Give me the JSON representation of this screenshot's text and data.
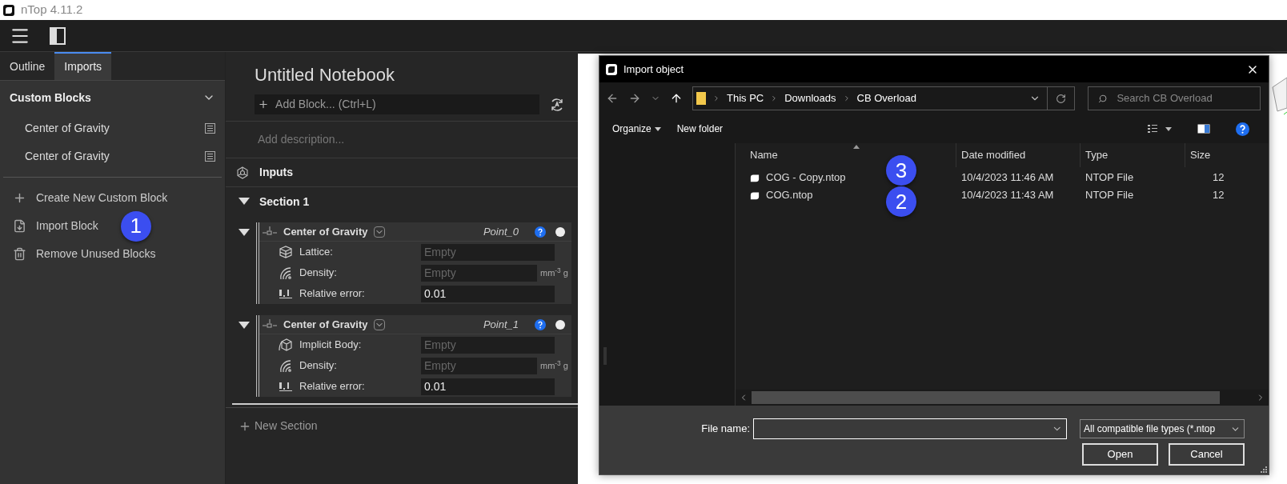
{
  "window": {
    "title": "nTop 4.11.2"
  },
  "sidebar": {
    "tabs": [
      {
        "label": "Outline",
        "selected": false
      },
      {
        "label": "Imports",
        "selected": true
      }
    ],
    "custom_blocks": {
      "title": "Custom Blocks",
      "expanded": true,
      "items": [
        "Center of Gravity",
        "Center of Gravity"
      ]
    },
    "actions": [
      {
        "kind": "create",
        "label": "Create New Custom Block"
      },
      {
        "kind": "import",
        "label": "Import Block",
        "callout": "1"
      },
      {
        "kind": "remove",
        "label": "Remove Unused Blocks"
      }
    ]
  },
  "notebook": {
    "title": "Untitled Notebook",
    "add_block": {
      "placeholder": "Add Block... (Ctrl+L)"
    },
    "description": {
      "placeholder": "Add description..."
    },
    "inputs": "Inputs",
    "section": {
      "title": "Section 1",
      "expanded": true,
      "blocks": [
        {
          "title": "Center of Gravity",
          "variable": "Point_0",
          "expanded": true,
          "params": [
            {
              "kind": "lattice",
              "label": "Lattice:",
              "placeholder": "Empty"
            },
            {
              "kind": "density",
              "label": "Density:",
              "placeholder": "Empty",
              "unit": "mm$^{-3}$ g"
            },
            {
              "kind": "number",
              "label": "Relative error:",
              "value": "0.01"
            }
          ]
        },
        {
          "title": "Center of Gravity",
          "variable": "Point_1",
          "expanded": true,
          "params": [
            {
              "kind": "body",
              "label": "Implicit Body:",
              "placeholder": "Empty"
            },
            {
              "kind": "density",
              "label": "Density:",
              "placeholder": "Empty",
              "unit": "mm$^{-3}$ g"
            },
            {
              "kind": "number",
              "label": "Relative error:",
              "value": "0.01"
            }
          ]
        }
      ]
    },
    "new_section": "New Section"
  },
  "dialog": {
    "title": "Import object",
    "path": [
      "This PC",
      "Downloads",
      "CB Overload"
    ],
    "search": {
      "placeholder": "Search CB Overload"
    },
    "toolbar": [
      "Organize",
      "New folder"
    ],
    "columns": [
      "Name",
      "Date modified",
      "Type",
      "Size"
    ],
    "files": [
      {
        "name": "COG - Copy.ntop",
        "date": "10/4/2023 11:46 AM",
        "type": "NTOP File",
        "size": "12",
        "callout": "3"
      },
      {
        "name": "COG.ntop",
        "date": "10/4/2023 11:43 AM",
        "type": "NTOP File",
        "size": "12",
        "callout": "2"
      }
    ],
    "file_name_label": "File name:",
    "file_type": "All compatible file types (*.ntop",
    "buttons": [
      "Open",
      "Cancel"
    ]
  }
}
